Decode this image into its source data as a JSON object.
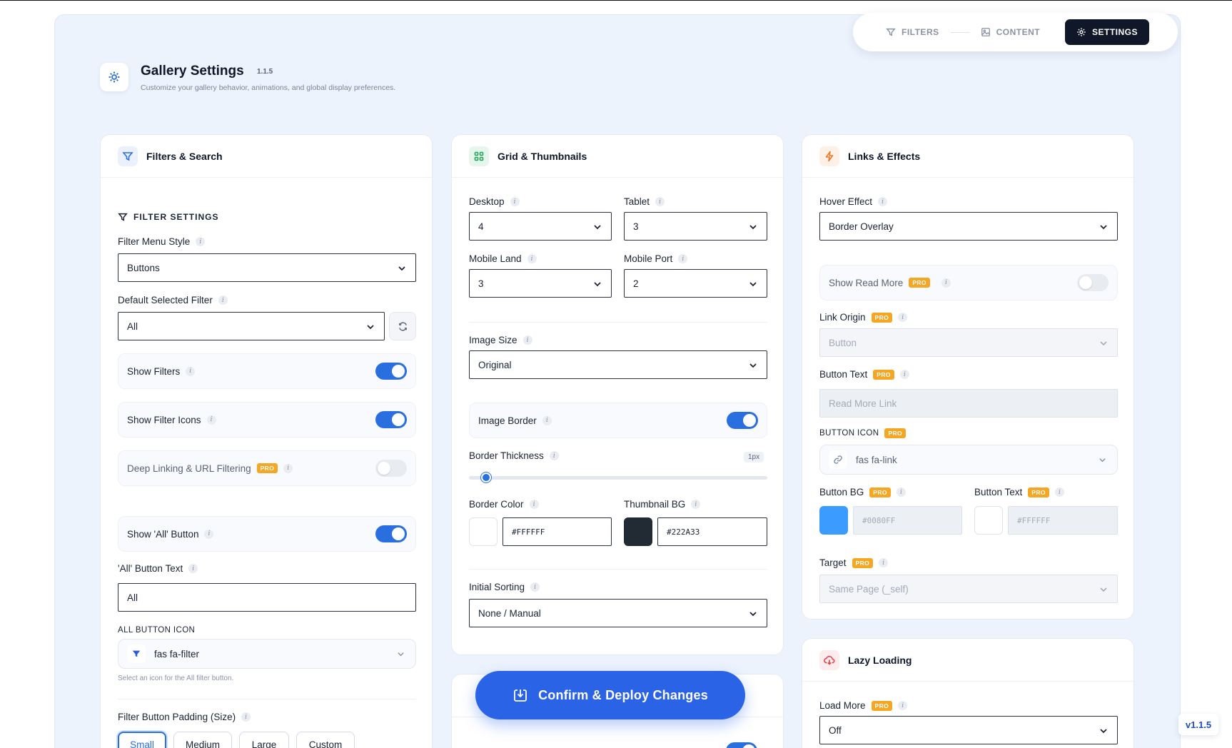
{
  "tabs": [
    {
      "label": "FILTERS",
      "icon": "funnel-icon"
    },
    {
      "label": "CONTENT",
      "icon": "image-icon"
    },
    {
      "label": "SETTINGS",
      "icon": "gear-icon",
      "active": true
    }
  ],
  "header": {
    "title": "Gallery Settings",
    "version": "1.1.5",
    "subtitle": "Customize your gallery behavior, animations, and global display preferences."
  },
  "filters_card": {
    "title": "Filters & Search",
    "section_label": "FILTER SETTINGS",
    "menu_style_label": "Filter Menu Style",
    "menu_style_value": "Buttons",
    "default_filter_label": "Default Selected Filter",
    "default_filter_value": "All",
    "show_filters_label": "Show Filters",
    "show_filters_on": true,
    "show_filter_icons_label": "Show Filter Icons",
    "show_filter_icons_on": true,
    "deep_linking_label": "Deep Linking & URL Filtering",
    "deep_linking_on": false,
    "show_all_label": "Show 'All' Button",
    "show_all_on": true,
    "all_text_label": "'All' Button Text",
    "all_text_value": "All",
    "all_icon_label": "ALL BUTTON ICON",
    "all_icon_value": "fas fa-filter",
    "all_icon_hint": "Select an icon for the All filter button.",
    "padding_label": "Filter Button Padding (Size)",
    "padding_options": [
      "Small",
      "Medium",
      "Large",
      "Custom"
    ],
    "padding_selected": "Small"
  },
  "grid_card": {
    "title": "Grid & Thumbnails",
    "desktop_label": "Desktop",
    "desktop_value": "4",
    "tablet_label": "Tablet",
    "tablet_value": "3",
    "mobile_land_label": "Mobile Land",
    "mobile_land_value": "3",
    "mobile_port_label": "Mobile Port",
    "mobile_port_value": "2",
    "image_size_label": "Image Size",
    "image_size_value": "Original",
    "image_border_label": "Image Border",
    "image_border_on": true,
    "border_thickness_label": "Border Thickness",
    "border_thickness_value": "1px",
    "border_color_label": "Border Color",
    "border_color_value": "#FFFFFF",
    "thumb_bg_label": "Thumbnail BG",
    "thumb_bg_value": "#222A33",
    "initial_sorting_label": "Initial Sorting",
    "initial_sorting_value": "None / Manual"
  },
  "links_card": {
    "title": "Links & Effects",
    "hover_label": "Hover Effect",
    "hover_value": "Border Overlay",
    "read_more_label": "Show Read More",
    "read_more_on": false,
    "link_origin_label": "Link Origin",
    "link_origin_value": "Button",
    "button_text_label": "Button Text",
    "button_text_value": "Read More Link",
    "button_icon_label": "BUTTON ICON",
    "button_icon_value": "fas fa-link",
    "button_bg_label": "Button BG",
    "button_bg_value": "#0080FF",
    "button_text_color_label": "Button Text",
    "button_text_color_value": "#FFFFFF",
    "target_label": "Target",
    "target_value": "Same Page (_self)"
  },
  "lazy_card": {
    "title": "Lazy Loading",
    "load_more_label": "Load More",
    "load_more_value": "Off"
  },
  "pro_label": "PRO",
  "deploy_label": "Confirm & Deploy Changes",
  "version_badge": "v1.1.5",
  "colors": {
    "accent": "#2A63E6",
    "dark": "#0F1729",
    "pro": "#F5A623",
    "button_bg_swatch": "#3B9BFF",
    "thumb_bg_swatch": "#222A33"
  }
}
